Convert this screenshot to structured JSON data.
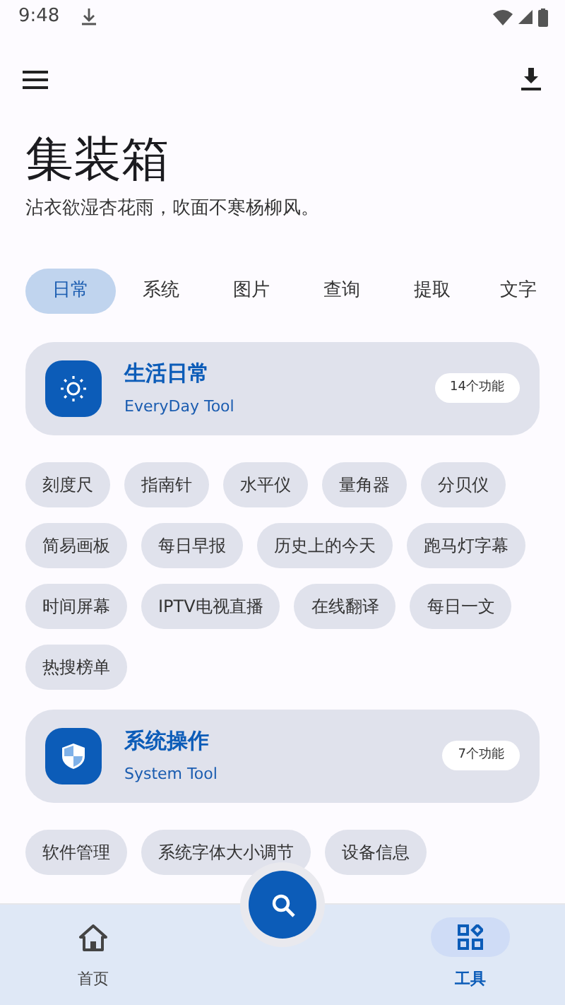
{
  "status_bar": {
    "time": "9:48"
  },
  "app_title": "集装箱",
  "subtitle": "沾衣欲湿杏花雨，吹面不寒杨柳风。",
  "tabs": [
    {
      "label": "日常",
      "selected": true
    },
    {
      "label": "系统",
      "selected": false
    },
    {
      "label": "图片",
      "selected": false
    },
    {
      "label": "查询",
      "selected": false
    },
    {
      "label": "提取",
      "selected": false
    },
    {
      "label": "文字",
      "selected": false
    }
  ],
  "sections": [
    {
      "kind": "daily",
      "title": "生活日常",
      "subtitle": "EveryDay Tool",
      "count": "14个功能",
      "tools": [
        "刻度尺",
        "指南针",
        "水平仪",
        "量角器",
        "分贝仪",
        "简易画板",
        "每日早报",
        "历史上的今天",
        "跑马灯字幕",
        "时间屏幕",
        "IPTV电视直播",
        "在线翻译",
        "每日一文",
        "热搜榜单"
      ]
    },
    {
      "kind": "system",
      "title": "系统操作",
      "subtitle": "System Tool",
      "count": "7个功能",
      "tools": [
        "软件管理",
        "系统字体大小调节",
        "设备信息"
      ]
    }
  ],
  "bottom_nav": [
    {
      "kind": "home",
      "label": "首页",
      "selected": false
    },
    {
      "kind": "tools",
      "label": "工具",
      "selected": true
    }
  ]
}
